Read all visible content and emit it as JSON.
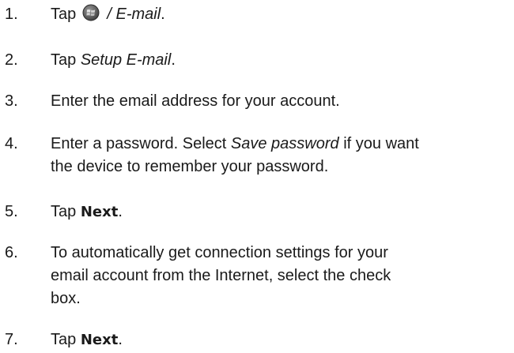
{
  "steps": [
    {
      "number": "1.",
      "parts": {
        "prefix": "Tap",
        "icon": "windows-start-icon",
        "separator": "/",
        "target": "E-mail",
        "suffix": "."
      }
    },
    {
      "number": "2.",
      "parts": {
        "prefix": "Tap",
        "target": "Setup E-mail",
        "suffix": "."
      }
    },
    {
      "number": "3.",
      "text": "Enter the email address for your account."
    },
    {
      "number": "4.",
      "parts": {
        "prefix": "Enter a password. Select",
        "target": "Save password",
        "suffix_line1": "if you want",
        "line2": "the device to remember your password."
      }
    },
    {
      "number": "5.",
      "parts": {
        "prefix": "Tap",
        "target": "Next",
        "suffix": "."
      }
    },
    {
      "number": "6.",
      "lines": [
        "To automatically get connection settings for your",
        "email account from the Internet, select the check",
        "box."
      ]
    },
    {
      "number": "7.",
      "parts": {
        "prefix": "Tap",
        "target": "Next",
        "suffix": "."
      }
    }
  ]
}
